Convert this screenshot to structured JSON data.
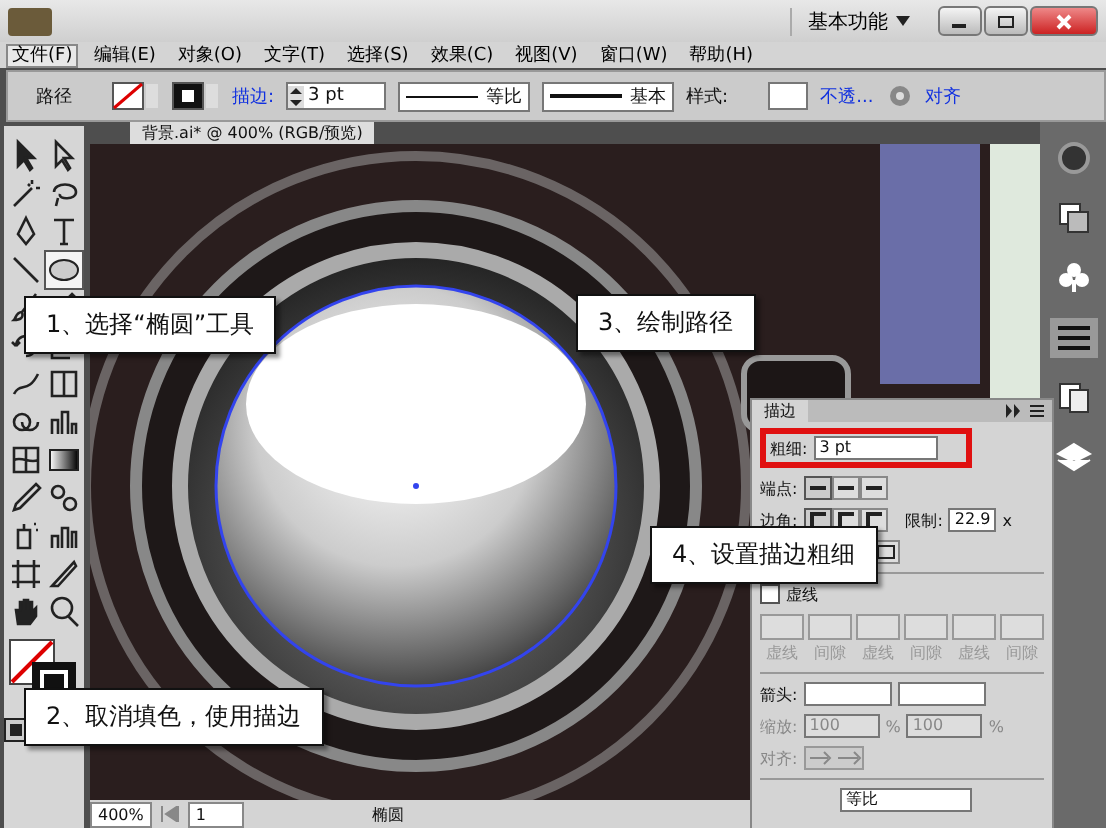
{
  "title_bar": {
    "workspace": "基本功能"
  },
  "menu": [
    {
      "label": "文件(F)",
      "selected": true
    },
    {
      "label": "编辑(E)",
      "selected": false
    },
    {
      "label": "对象(O)",
      "selected": false
    },
    {
      "label": "文字(T)",
      "selected": false
    },
    {
      "label": "选择(S)",
      "selected": false
    },
    {
      "label": "效果(C)",
      "selected": false
    },
    {
      "label": "视图(V)",
      "selected": false
    },
    {
      "label": "窗口(W)",
      "selected": false
    },
    {
      "label": "帮助(H)",
      "selected": false
    }
  ],
  "control_bar": {
    "object_type": "路径",
    "stroke_label": "描边:",
    "stroke_weight": "3 pt",
    "profile": "等比",
    "brush": "基本",
    "style_label": "样式:",
    "opacity_link": "不透...",
    "align_link": "对齐"
  },
  "tools": [
    {
      "kind": "select",
      "selected": false
    },
    {
      "kind": "direct",
      "selected": false
    },
    {
      "kind": "wand",
      "selected": false
    },
    {
      "kind": "lasso",
      "selected": false
    },
    {
      "kind": "pen",
      "selected": false
    },
    {
      "kind": "type",
      "selected": false
    },
    {
      "kind": "line",
      "selected": false
    },
    {
      "kind": "ellipse",
      "selected": true
    },
    {
      "kind": "brush",
      "selected": false
    },
    {
      "kind": "pencil",
      "selected": false
    },
    {
      "kind": "rotate",
      "selected": false
    },
    {
      "kind": "scale",
      "selected": false
    },
    {
      "kind": "warp",
      "selected": false
    },
    {
      "kind": "transform",
      "selected": false
    },
    {
      "kind": "builder",
      "selected": false
    },
    {
      "kind": "graph",
      "selected": false
    },
    {
      "kind": "mesh",
      "selected": false
    },
    {
      "kind": "gradient",
      "selected": false
    },
    {
      "kind": "eyedropper",
      "selected": false
    },
    {
      "kind": "blend",
      "selected": false
    },
    {
      "kind": "spray",
      "selected": false
    },
    {
      "kind": "column",
      "selected": false
    },
    {
      "kind": "artboard",
      "selected": false
    },
    {
      "kind": "knife",
      "selected": false
    },
    {
      "kind": "hand",
      "selected": false
    },
    {
      "kind": "zoom",
      "selected": false
    }
  ],
  "document_tab": "背景.ai* @ 400% (RGB/预览)",
  "callouts": [
    {
      "text": "1、选择“椭圆”工具"
    },
    {
      "text": "3、绘制路径"
    },
    {
      "text": "4、设置描边粗细"
    },
    {
      "text": "2、取消填色，使用描边"
    }
  ],
  "stroke_panel": {
    "title": "描边",
    "weight_label": "粗细:",
    "weight": "3 pt",
    "cap_label": "端点:",
    "corner_label": "边角:",
    "limit_label": "限制:",
    "limit": "22.9",
    "limit_unit": "x",
    "dashed": {
      "label": "虚线",
      "checked": false
    },
    "dash_labels": [
      "虚线",
      "间隙",
      "虚线",
      "间隙",
      "虚线",
      "间隙"
    ],
    "arrow_label": "箭头:",
    "scale_label": "缩放:",
    "scale": [
      "100",
      "100"
    ],
    "percent": "%",
    "align_label": "对齐:",
    "profile": "等比"
  },
  "status_bar": {
    "zoom": "400%",
    "page": "1",
    "tool": "椭圆"
  }
}
